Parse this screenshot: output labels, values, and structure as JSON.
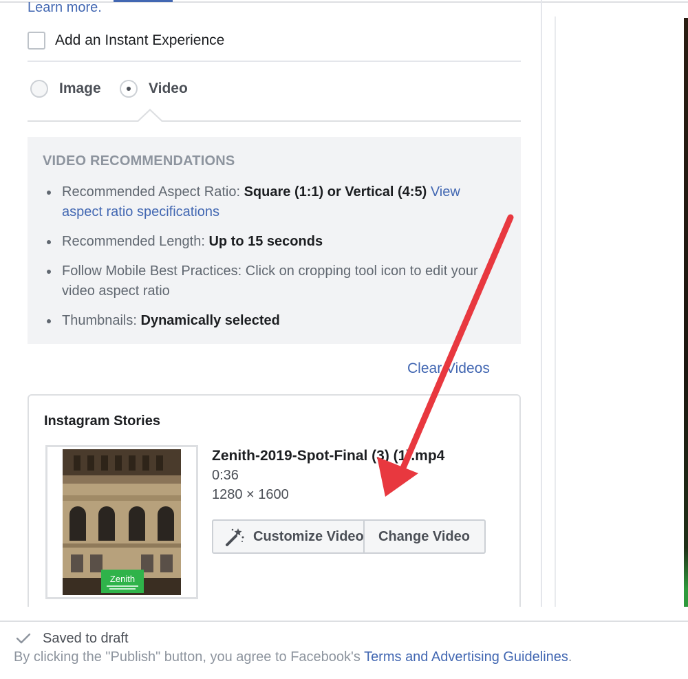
{
  "header": {
    "learn_more": "Learn more."
  },
  "instant_experience": {
    "label": "Add an Instant Experience",
    "checked": false
  },
  "media_type": {
    "options": [
      {
        "label": "Image",
        "selected": false
      },
      {
        "label": "Video",
        "selected": true
      }
    ]
  },
  "recommendations": {
    "title": "VIDEO RECOMMENDATIONS",
    "aspect": {
      "label": "Recommended Aspect Ratio: ",
      "value": "Square (1:1) or Vertical (4:5)",
      "link": "View aspect ratio specifications"
    },
    "length": {
      "label": "Recommended Length: ",
      "value": "Up to 15 seconds"
    },
    "mobile": {
      "text": "Follow Mobile Best Practices: Click on cropping tool icon to edit your video aspect ratio"
    },
    "thumbnails": {
      "label": "Thumbnails: ",
      "value": "Dynamically selected"
    }
  },
  "clear_videos": "Clear Videos",
  "story": {
    "title": "Instagram Stories",
    "thumbnail_logo": "Zenith",
    "file_name": "Zenith-2019-Spot-Final (3) (1).mp4",
    "duration": "0:36",
    "dimensions": "1280 × 1600",
    "customize_label": "Customize Video",
    "change_label": "Change Video"
  },
  "footer": {
    "saved": "Saved to draft",
    "agree_prefix": "By clicking the \"Publish\" button, you agree to Facebook's ",
    "agree_link": "Terms and Advertising Guidelines",
    "agree_suffix": "."
  },
  "colors": {
    "link": "#4267b2",
    "annotation_arrow": "#e8383f",
    "thumbnail_logo_bg": "#2fb34a"
  },
  "icons": [
    "checkbox",
    "radio",
    "magic-wand-icon",
    "checkmark-icon",
    "annotation-arrow"
  ]
}
